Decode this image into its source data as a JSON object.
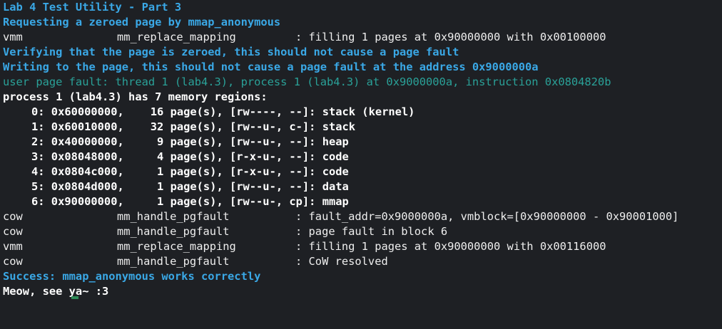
{
  "window": {
    "title": "Lab 4 Test Utility - Part 3"
  },
  "colors": {
    "background": "#1e2024",
    "info": "#3aa8e6",
    "fault": "#2aa198",
    "text": "#eeeeee"
  },
  "lines": {
    "l1": "Requesting a zeroed page by mmap_anonymous",
    "l2": {
      "tag": "vmm",
      "func": "mm_replace_mapping",
      "msg": ": filling 1 pages at 0x90000000 with 0x00100000"
    },
    "l3": "Verifying that the page is zeroed, this should not cause a page fault",
    "l4": "Writing to the page, this should not cause a page fault at the address 0x9000000a",
    "l5": "user page fault: thread 1 (lab4.3), process 1 (lab4.3) at 0x9000000a, instruction 0x0804820b",
    "l6": "process 1 (lab4.3) has 7 memory regions:",
    "regions": [
      "0: 0x60000000,    16 page(s), [rw----, --]: stack (kernel)",
      "1: 0x60010000,    32 page(s), [rw--u-, c-]: stack",
      "2: 0x40000000,     9 page(s), [rw--u-, --]: heap",
      "3: 0x08048000,     4 page(s), [r-x-u-, --]: code",
      "4: 0x0804c000,     1 page(s), [r-x-u-, --]: code",
      "5: 0x0804d000,     1 page(s), [rw--u-, --]: data",
      "6: 0x90000000,     1 page(s), [rw--u-, cp]: mmap"
    ],
    "log": [
      {
        "tag": "cow",
        "func": "mm_handle_pgfault",
        "msg": ": fault_addr=0x9000000a, vmblock=[0x90000000 - 0x90001000]"
      },
      {
        "tag": "cow",
        "func": "mm_handle_pgfault",
        "msg": ": page fault in block 6"
      },
      {
        "tag": "vmm",
        "func": "mm_replace_mapping",
        "msg": ": filling 1 pages at 0x90000000 with 0x00116000"
      },
      {
        "tag": "cow",
        "func": "mm_handle_pgfault",
        "msg": ": CoW resolved"
      }
    ],
    "success": "Success: mmap_anonymous works correctly",
    "prompt": "Meow, see ya~ :3"
  }
}
